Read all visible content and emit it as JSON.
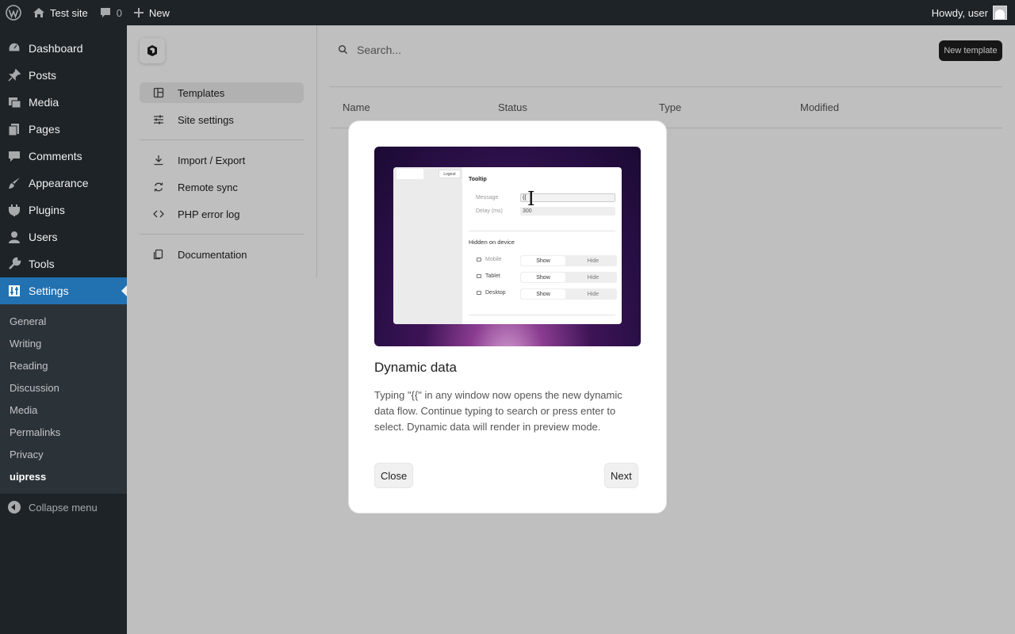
{
  "adminbar": {
    "site_name": "Test site",
    "comments_count": "0",
    "new_label": "New",
    "greeting": "Howdy, user"
  },
  "admin_menu": {
    "items": [
      {
        "label": "Dashboard",
        "icon": "dashboard-icon"
      },
      {
        "label": "Posts",
        "icon": "pin-icon"
      },
      {
        "label": "Media",
        "icon": "media-icon"
      },
      {
        "label": "Pages",
        "icon": "pages-icon"
      },
      {
        "label": "Comments",
        "icon": "comment-icon"
      },
      {
        "label": "Appearance",
        "icon": "brush-icon"
      },
      {
        "label": "Plugins",
        "icon": "plug-icon"
      },
      {
        "label": "Users",
        "icon": "user-icon"
      },
      {
        "label": "Tools",
        "icon": "wrench-icon"
      },
      {
        "label": "Settings",
        "icon": "settings-icon"
      }
    ],
    "active": "Settings",
    "submenu": [
      "General",
      "Writing",
      "Reading",
      "Discussion",
      "Media",
      "Permalinks",
      "Privacy",
      "uipress"
    ],
    "submenu_current": "uipress",
    "collapse_label": "Collapse menu"
  },
  "app_nav": {
    "items": [
      {
        "label": "Templates",
        "icon": "template-icon"
      },
      {
        "label": "Site settings",
        "icon": "sliders-icon"
      },
      {
        "label": "Import / Export",
        "icon": "download-icon"
      },
      {
        "label": "Remote sync",
        "icon": "sync-icon"
      },
      {
        "label": "PHP error log",
        "icon": "code-icon"
      },
      {
        "label": "Documentation",
        "icon": "docs-icon"
      }
    ],
    "active": "Templates"
  },
  "toolbar": {
    "search_placeholder": "Search...",
    "new_template_label": "New template"
  },
  "table": {
    "columns": [
      "Name",
      "Status",
      "Type",
      "Modified"
    ]
  },
  "modal": {
    "title": "Dynamic data",
    "description": "Typing \"{{\" in any window now opens the new dynamic data flow. Continue typing to search or press enter to select. Dynamic data will render in preview mode.",
    "close_label": "Close",
    "next_label": "Next",
    "preview": {
      "logout": "Logout",
      "heading": "Tooltip",
      "message_label": "Message",
      "message_value": "{{",
      "delay_label": "Delay (ms)",
      "delay_value": "300",
      "hidden_label": "Hidden on device",
      "devices": [
        "Mobile",
        "Tablet",
        "Desktop"
      ],
      "show": "Show",
      "hide": "Hide"
    }
  }
}
